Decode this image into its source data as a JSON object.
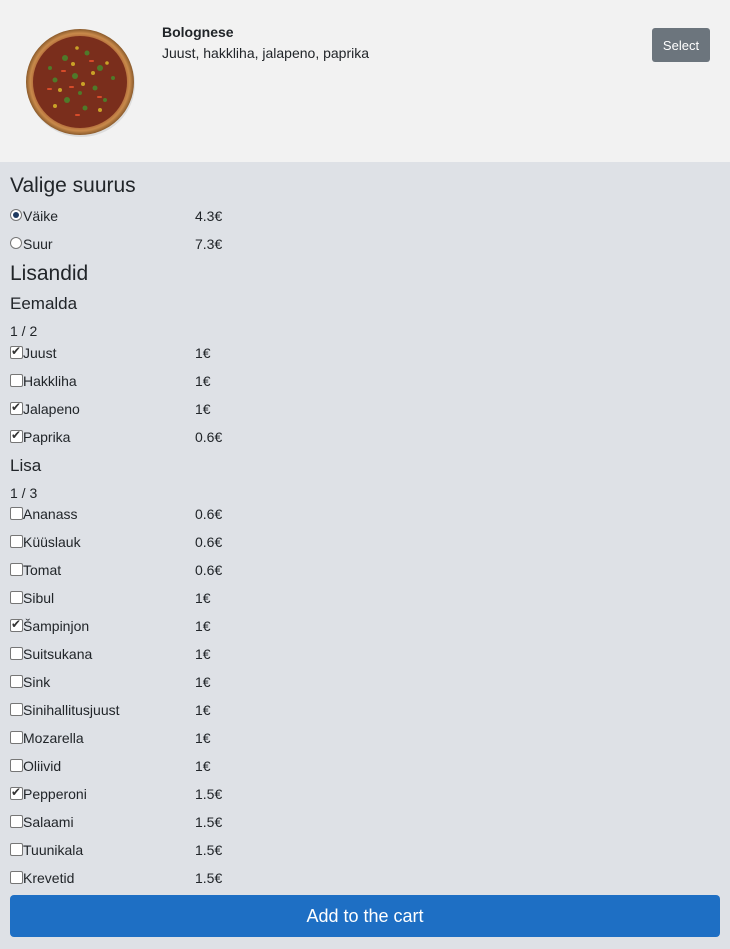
{
  "pizza": {
    "name": "Bolognese",
    "description": "Juust, hakkliha, jalapeno, paprika",
    "select_label": "Select"
  },
  "size_section": {
    "title": "Valige suurus",
    "options": [
      {
        "label": "Väike",
        "price": "4.3€",
        "selected": true
      },
      {
        "label": "Suur",
        "price": "7.3€",
        "selected": false
      }
    ]
  },
  "extras": {
    "title": "Lisandid",
    "remove": {
      "title": "Eemalda",
      "counter": "1 / 2",
      "items": [
        {
          "label": "Juust",
          "price": "1€",
          "checked": true
        },
        {
          "label": "Hakkliha",
          "price": "1€",
          "checked": false
        },
        {
          "label": "Jalapeno",
          "price": "1€",
          "checked": true
        },
        {
          "label": "Paprika",
          "price": "0.6€",
          "checked": true
        }
      ]
    },
    "add": {
      "title": "Lisa",
      "counter": "1 / 3",
      "items": [
        {
          "label": "Ananass",
          "price": "0.6€",
          "checked": false
        },
        {
          "label": "Küüslauk",
          "price": "0.6€",
          "checked": false
        },
        {
          "label": "Tomat",
          "price": "0.6€",
          "checked": false
        },
        {
          "label": "Sibul",
          "price": "1€",
          "checked": false
        },
        {
          "label": "Šampinjon",
          "price": "1€",
          "checked": true
        },
        {
          "label": "Suitsukana",
          "price": "1€",
          "checked": false
        },
        {
          "label": "Sink",
          "price": "1€",
          "checked": false
        },
        {
          "label": "Sinihallitusjuust",
          "price": "1€",
          "checked": false
        },
        {
          "label": "Mozarella",
          "price": "1€",
          "checked": false
        },
        {
          "label": "Oliivid",
          "price": "1€",
          "checked": false
        },
        {
          "label": "Pepperoni",
          "price": "1.5€",
          "checked": true
        },
        {
          "label": "Salaami",
          "price": "1.5€",
          "checked": false
        },
        {
          "label": "Tuunikala",
          "price": "1.5€",
          "checked": false
        },
        {
          "label": "Krevetid",
          "price": "1.5€",
          "checked": false
        }
      ]
    }
  },
  "cart_button_label": "Add to the cart",
  "colors": {
    "header_bg": "#f2f2f2",
    "page_bg": "#dee1e6",
    "select_button": "#6c757d",
    "cart_button": "#1e6fc4"
  }
}
